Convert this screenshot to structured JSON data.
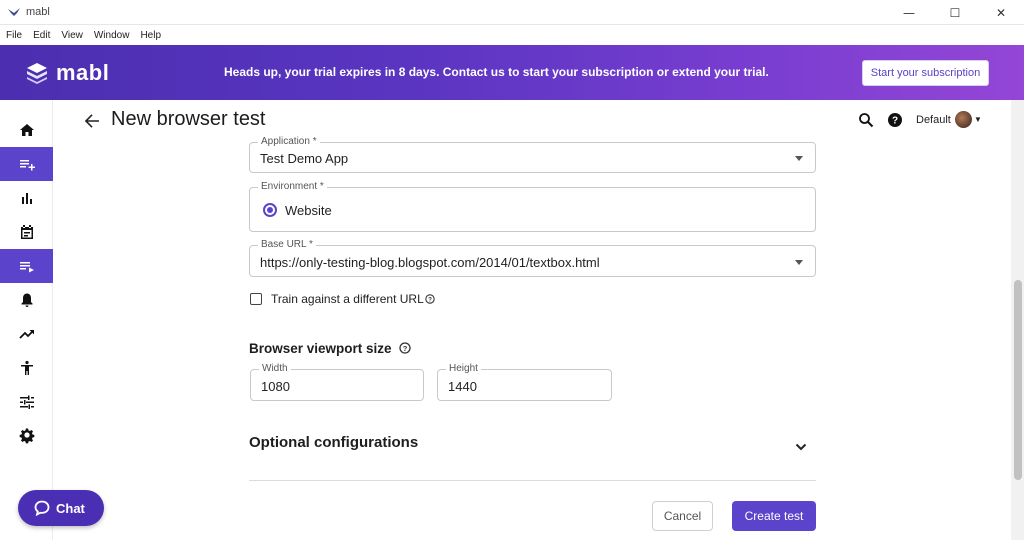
{
  "window": {
    "title": "mabl",
    "controls": [
      "—",
      "☐",
      "✕"
    ]
  },
  "menu": [
    "File",
    "Edit",
    "View",
    "Window",
    "Help"
  ],
  "banner": {
    "logo_text": "mabl",
    "message": "Heads up, your trial expires in 8 days. Contact us to start your subscription or extend your trial.",
    "subscription_button": "Start your subscription"
  },
  "sidebar": {
    "items": [
      {
        "icon": "home-icon",
        "active": false
      },
      {
        "icon": "playlist-add-icon",
        "active": true
      },
      {
        "icon": "bar-chart-icon",
        "active": false
      },
      {
        "icon": "calendar-icon",
        "active": false
      },
      {
        "icon": "playlist-play-icon",
        "active": true
      },
      {
        "icon": "bell-icon",
        "active": false
      },
      {
        "icon": "trending-up-icon",
        "active": false
      },
      {
        "icon": "accessibility-icon",
        "active": false
      },
      {
        "icon": "sliders-icon",
        "active": false
      },
      {
        "icon": "gear-icon",
        "active": false
      }
    ]
  },
  "header": {
    "title": "New browser test",
    "workspace": "Default"
  },
  "form": {
    "application": {
      "label": "Application *",
      "value": "Test Demo App"
    },
    "environment": {
      "label": "Environment *",
      "option": "Website",
      "selected": true
    },
    "base_url": {
      "label": "Base URL *",
      "value": "https://only-testing-blog.blogspot.com/2014/01/textbox.html"
    },
    "train_checkbox": {
      "label": "Train against a different URL",
      "checked": false
    },
    "viewport": {
      "heading": "Browser viewport size",
      "width_label": "Width",
      "width_value": "1080",
      "height_label": "Height",
      "height_value": "1440"
    },
    "optional": {
      "heading": "Optional configurations"
    },
    "buttons": {
      "cancel": "Cancel",
      "create": "Create test"
    }
  },
  "chat": {
    "label": "Chat"
  },
  "colors": {
    "accent": "#5b43cc",
    "banner_start": "#4b2fb0",
    "banner_end": "#9446d6"
  }
}
